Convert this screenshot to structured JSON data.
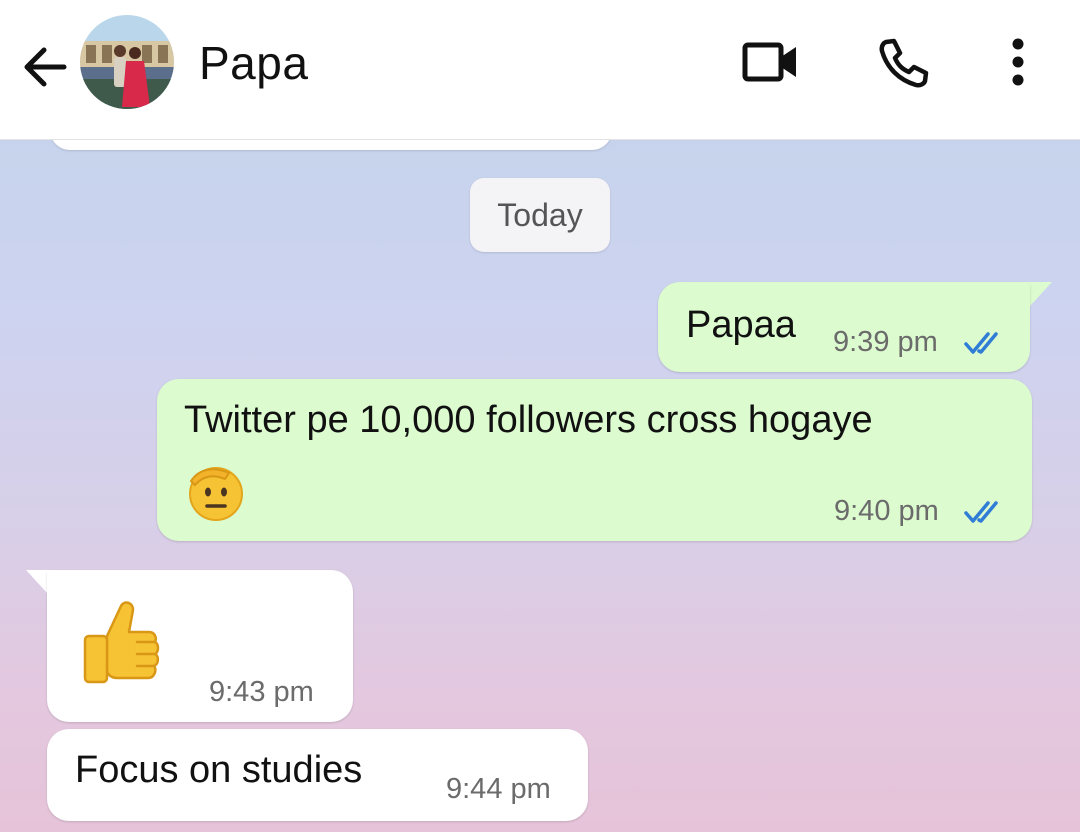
{
  "header": {
    "contact_name": "Papa",
    "icons": [
      "back-arrow-icon",
      "avatar",
      "video-call-icon",
      "phone-icon",
      "more-options-icon"
    ]
  },
  "chat": {
    "date_chip": "Today",
    "messages": [
      {
        "direction": "outgoing",
        "text": "Papaa",
        "time": "9:39 pm",
        "status": "read"
      },
      {
        "direction": "outgoing",
        "text": "Twitter pe 10,000 followers cross hogaye",
        "emoji": "saluting-face",
        "time": "9:40 pm",
        "status": "read"
      },
      {
        "direction": "incoming",
        "emoji": "thumbs-up",
        "time": "9:43 pm"
      },
      {
        "direction": "incoming",
        "text": "Focus on studies",
        "time": "9:44 pm"
      }
    ]
  },
  "colors": {
    "outgoing_bubble": "#dcfbcf",
    "incoming_bubble": "#ffffff",
    "read_ticks": "#2f7dd6"
  }
}
